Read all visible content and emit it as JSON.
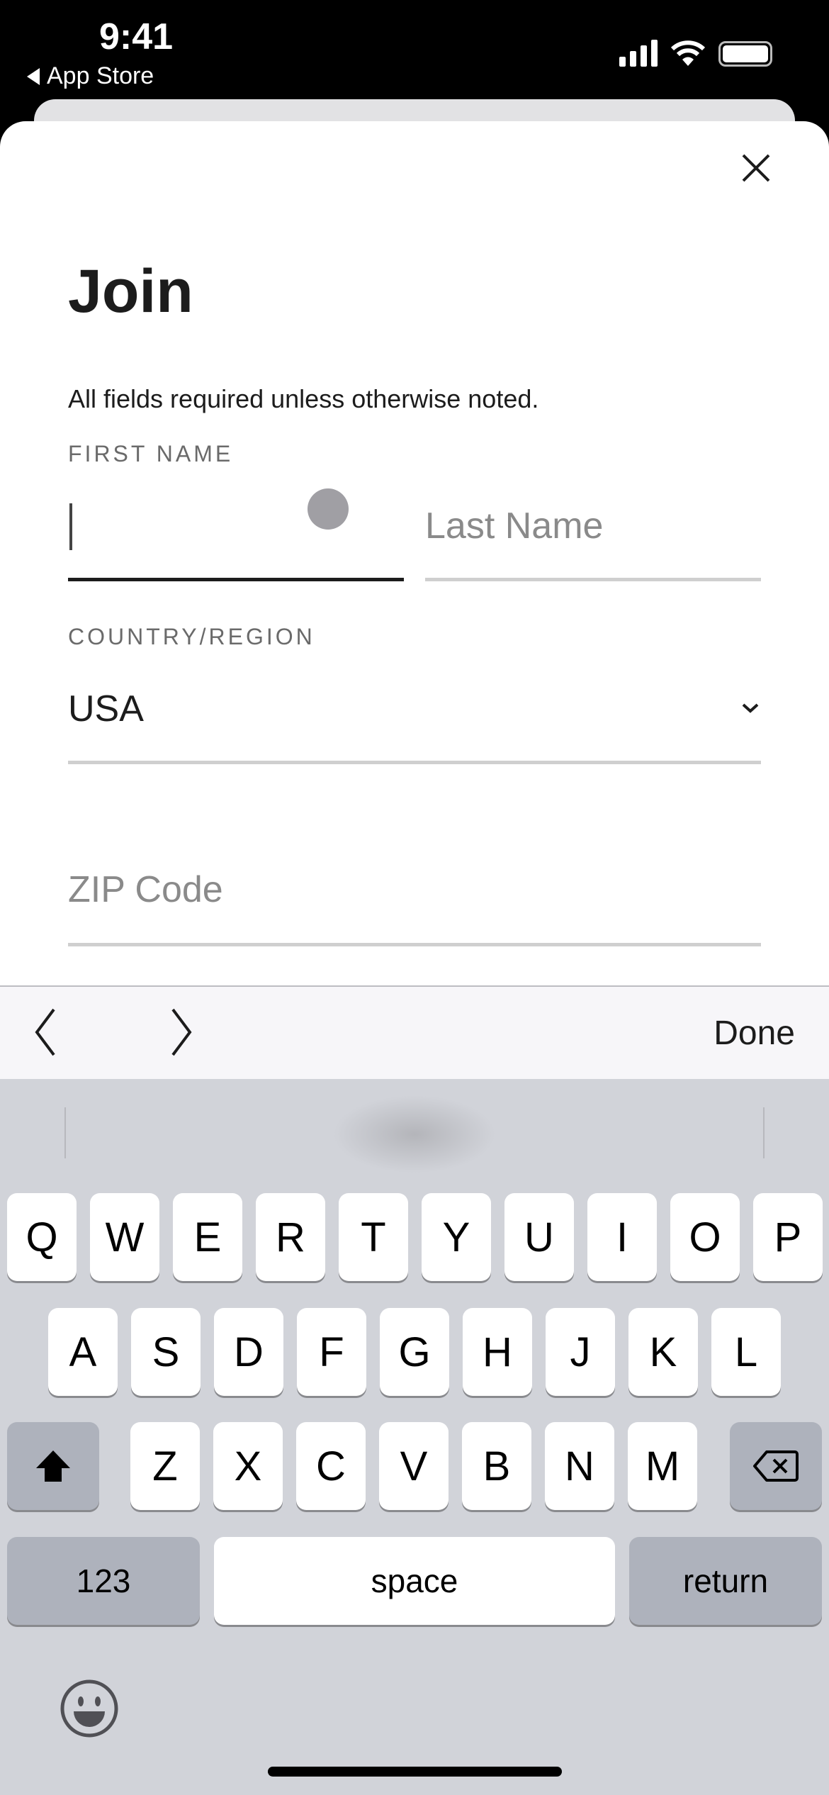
{
  "status_bar": {
    "time": "9:41",
    "back_label": "App Store",
    "icons": [
      "cellular-signal-icon",
      "wifi-icon",
      "battery-icon"
    ]
  },
  "sheet": {
    "close_icon": "close-icon",
    "title": "Join",
    "subtitle": "All fields required unless otherwise noted.",
    "first_name": {
      "label": "FIRST NAME",
      "value": ""
    },
    "last_name": {
      "placeholder": "Last Name"
    },
    "country": {
      "label": "COUNTRY/REGION",
      "value": "USA"
    },
    "zip": {
      "placeholder": "ZIP Code"
    }
  },
  "toolbar": {
    "prev_icon": "chevron-left-icon",
    "next_icon": "chevron-right-icon",
    "done_label": "Done"
  },
  "keyboard": {
    "row1": [
      "Q",
      "W",
      "E",
      "R",
      "T",
      "Y",
      "U",
      "I",
      "O",
      "P"
    ],
    "row2": [
      "A",
      "S",
      "D",
      "F",
      "G",
      "H",
      "J",
      "K",
      "L"
    ],
    "row3": [
      "Z",
      "X",
      "C",
      "V",
      "B",
      "N",
      "M"
    ],
    "numbers_label": "123",
    "space_label": "space",
    "return_label": "return"
  },
  "colors": {
    "keyboard_bg": "#d1d3d9",
    "toolbar_bg": "#f7f6f9",
    "active_underline": "#1c1c1c"
  }
}
